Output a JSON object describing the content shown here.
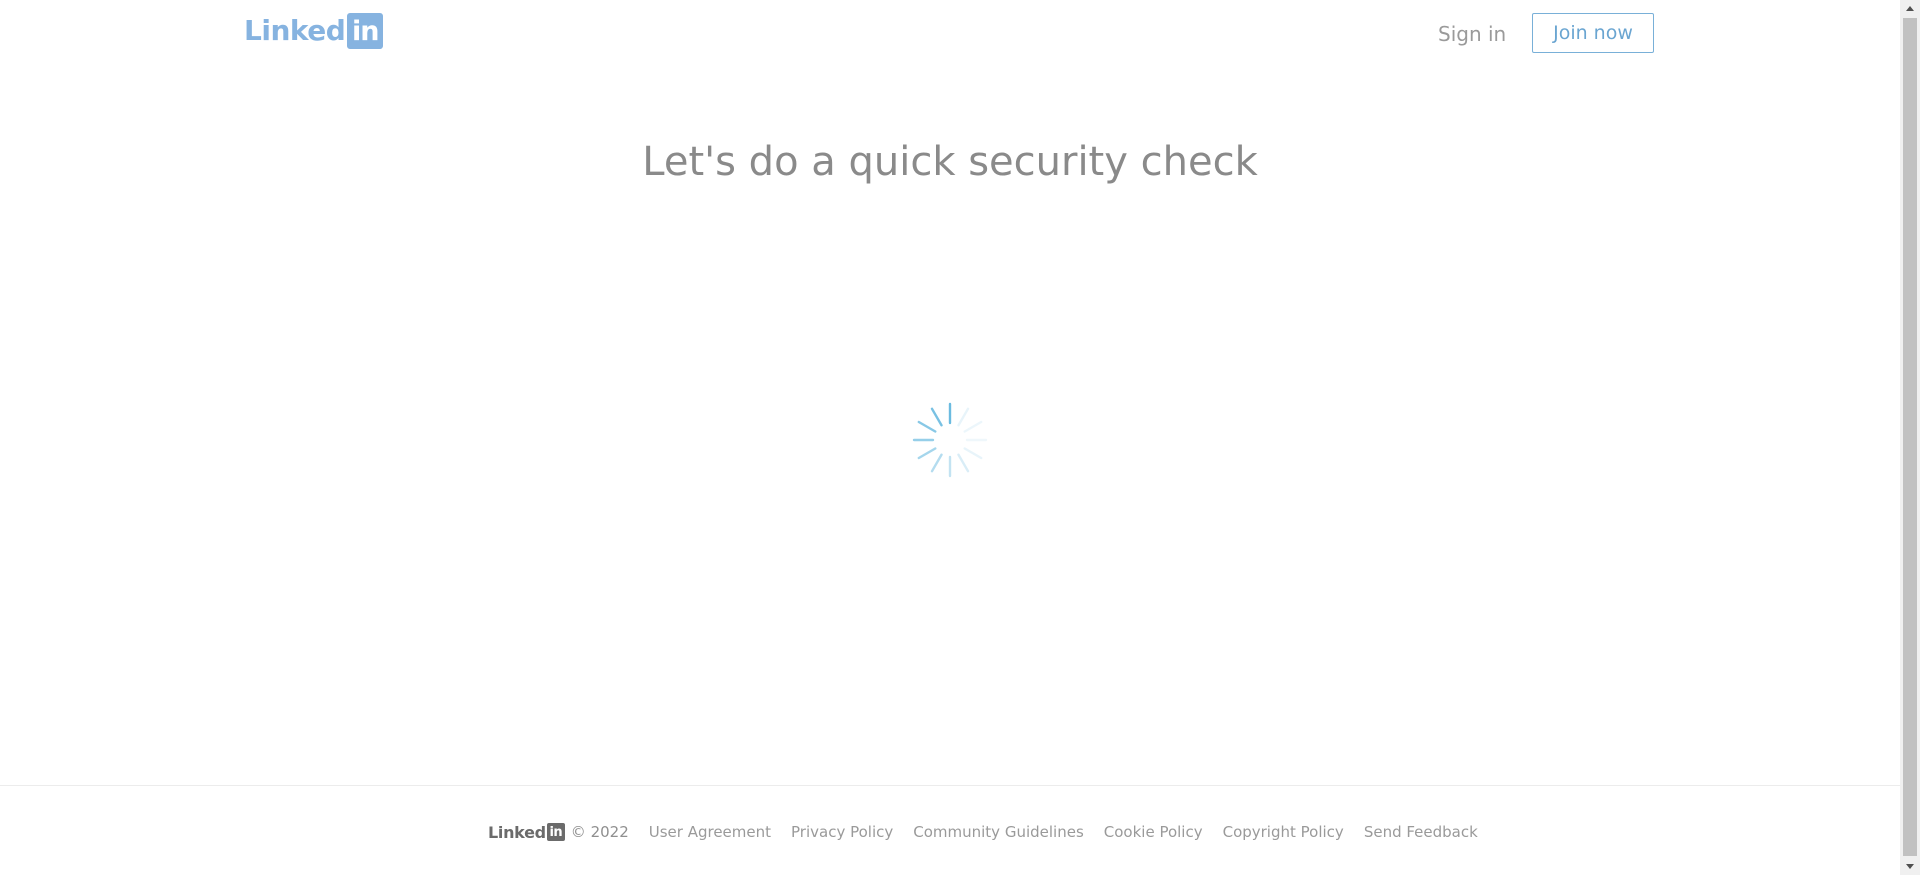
{
  "header": {
    "logo_word": "Linked",
    "logo_box": "in",
    "signin_label": "Sign in",
    "join_label": "Join now"
  },
  "main": {
    "title": "Let's do a quick security check",
    "loading_icon": "spinner-icon"
  },
  "footer": {
    "logo_word": "Linked",
    "logo_box": "in",
    "copyright": "© 2022",
    "links": [
      "User Agreement",
      "Privacy Policy",
      "Community Guidelines",
      "Cookie Policy",
      "Copyright Policy",
      "Send Feedback"
    ]
  },
  "colors": {
    "brand_light": "#86b3e0",
    "accent_button": "#6aa5d1",
    "spinner": "#6bbbe0",
    "text_muted": "#8a8a8a"
  }
}
